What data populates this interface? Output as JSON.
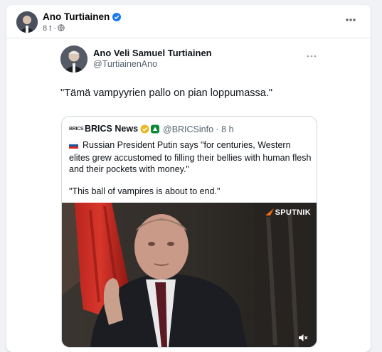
{
  "post": {
    "author": "Ano Turtiainen",
    "time": "8 t ·",
    "icons": {
      "avatar": "avatar",
      "verified": "verified-badge-icon",
      "audience": "globe-icon",
      "more": "more-options-icon"
    }
  },
  "tweet": {
    "name": "Ano Veli Samuel Turtiainen",
    "handle": "@TurtiainenAno",
    "text": "\"Tämä vampyyrien pallo on pian loppumassa.\"",
    "quote": {
      "logo": "BRICS",
      "name": "BRICS News",
      "handle": "@BRICSinfo · 8 h",
      "text": "Russian President Putin says \"for centuries, Western elites grew accustomed to filling their bellies with human flesh and their pockets with money.\"",
      "text2": "\"This ball of vampires is about to end.\"",
      "video_brand": "SPUTNIK",
      "icons": {
        "flag": "russian-flag-icon",
        "gold_badge": "gold-verified-icon",
        "affiliate": "affiliate-badge-icon",
        "mute": "speaker-mute-icon"
      }
    }
  },
  "colors": {
    "background": "#f0f2f5",
    "card": "#ffffff",
    "verified": "#1877f2",
    "secondary_text": "#65676b"
  }
}
